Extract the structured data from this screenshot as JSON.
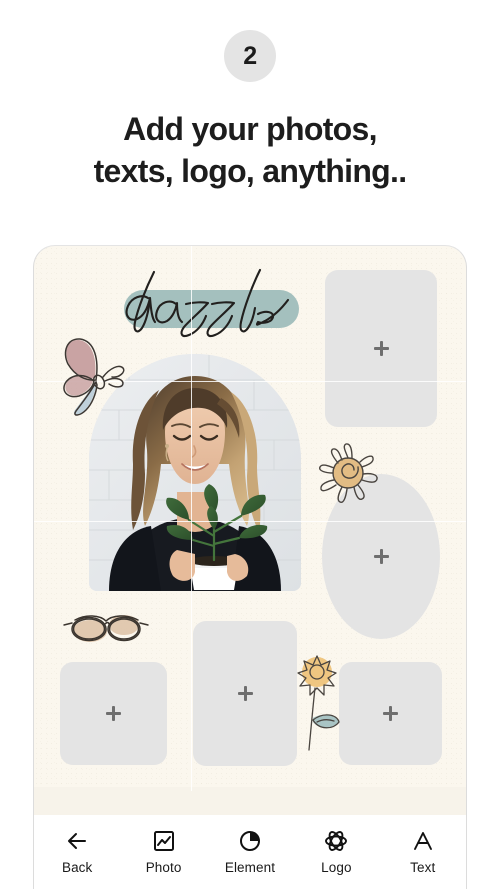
{
  "header": {
    "step_number": "2",
    "headline_line1": "Add your photos,",
    "headline_line2": "texts, logo, anything.."
  },
  "canvas": {
    "background_color": "#FBF7EE",
    "logo_text": "dazzle",
    "logo_highlight_color": "#A4C0BE",
    "photo": {
      "description": "Smiling woman with long blonde wavy hair in a black top holding a potted green plant in front of a white brick wall",
      "frame_shape": "arch"
    },
    "placeholders": [
      {
        "id": "top-right",
        "shape": "rounded-rect",
        "icon": "plus-icon"
      },
      {
        "id": "mid-right",
        "shape": "ellipse",
        "icon": "plus-icon"
      },
      {
        "id": "bottom-left",
        "shape": "rounded-rect",
        "icon": "plus-icon"
      },
      {
        "id": "bottom-mid",
        "shape": "rounded-rect",
        "icon": "plus-icon"
      },
      {
        "id": "bottom-right",
        "shape": "rounded-rect",
        "icon": "plus-icon"
      }
    ],
    "stickers": [
      {
        "id": "butterfly",
        "name": "butterfly-sticker",
        "colors": [
          "#C4A0A0",
          "#BCCCD6"
        ]
      },
      {
        "id": "sun",
        "name": "sun-sticker",
        "colors": [
          "#E2BC84"
        ]
      },
      {
        "id": "glasses",
        "name": "glasses-sticker",
        "colors": [
          "#DEC3A8"
        ]
      },
      {
        "id": "sunflower",
        "name": "sunflower-sticker",
        "colors": [
          "#EFC681",
          "#A9C4C4"
        ]
      }
    ],
    "guides": {
      "color": "#FFFFFF",
      "vertical_count": 1,
      "horizontal_count": 2
    }
  },
  "bottom_nav": {
    "items": [
      {
        "label": "Back",
        "icon": "arrow-left-icon"
      },
      {
        "label": "Photo",
        "icon": "image-icon"
      },
      {
        "label": "Element",
        "icon": "pie-circle-icon"
      },
      {
        "label": "Logo",
        "icon": "atom-flower-icon"
      },
      {
        "label": "Text",
        "icon": "letter-a-icon"
      }
    ]
  }
}
